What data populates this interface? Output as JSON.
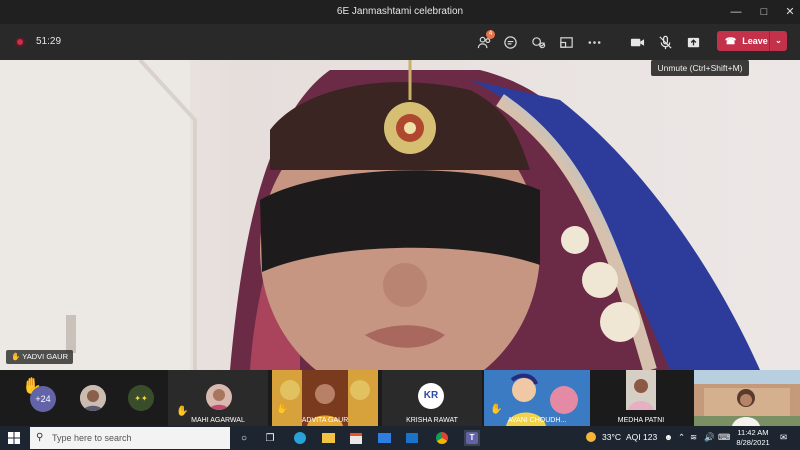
{
  "window": {
    "title": "6E Janmashtami celebration"
  },
  "meeting": {
    "timer": "51:29",
    "leave_label": "Leave",
    "tooltip": "Unmute (Ctrl+Shift+M)",
    "people_badge": "4"
  },
  "stage": {
    "speaker_name": "YADVI GAUR"
  },
  "participants": {
    "overflow_count": "+24",
    "tiles": [
      {
        "name": "MAHI AGARWAL"
      },
      {
        "name": "ADVITA GAUR"
      },
      {
        "name": "KRISHA RAWAT",
        "initials": "KR"
      },
      {
        "name": "AVANI CHOUDH..."
      },
      {
        "name": "MEDHA PATNI"
      }
    ]
  },
  "taskbar": {
    "search_placeholder": "Type here to search",
    "weather": "33°C",
    "aqi": "AQI 123",
    "time": "11:42 AM",
    "date": "8/28/2021"
  },
  "colors": {
    "leave": "#c4314b",
    "toolbar": "#292929",
    "taskbar": "#1c2530"
  }
}
